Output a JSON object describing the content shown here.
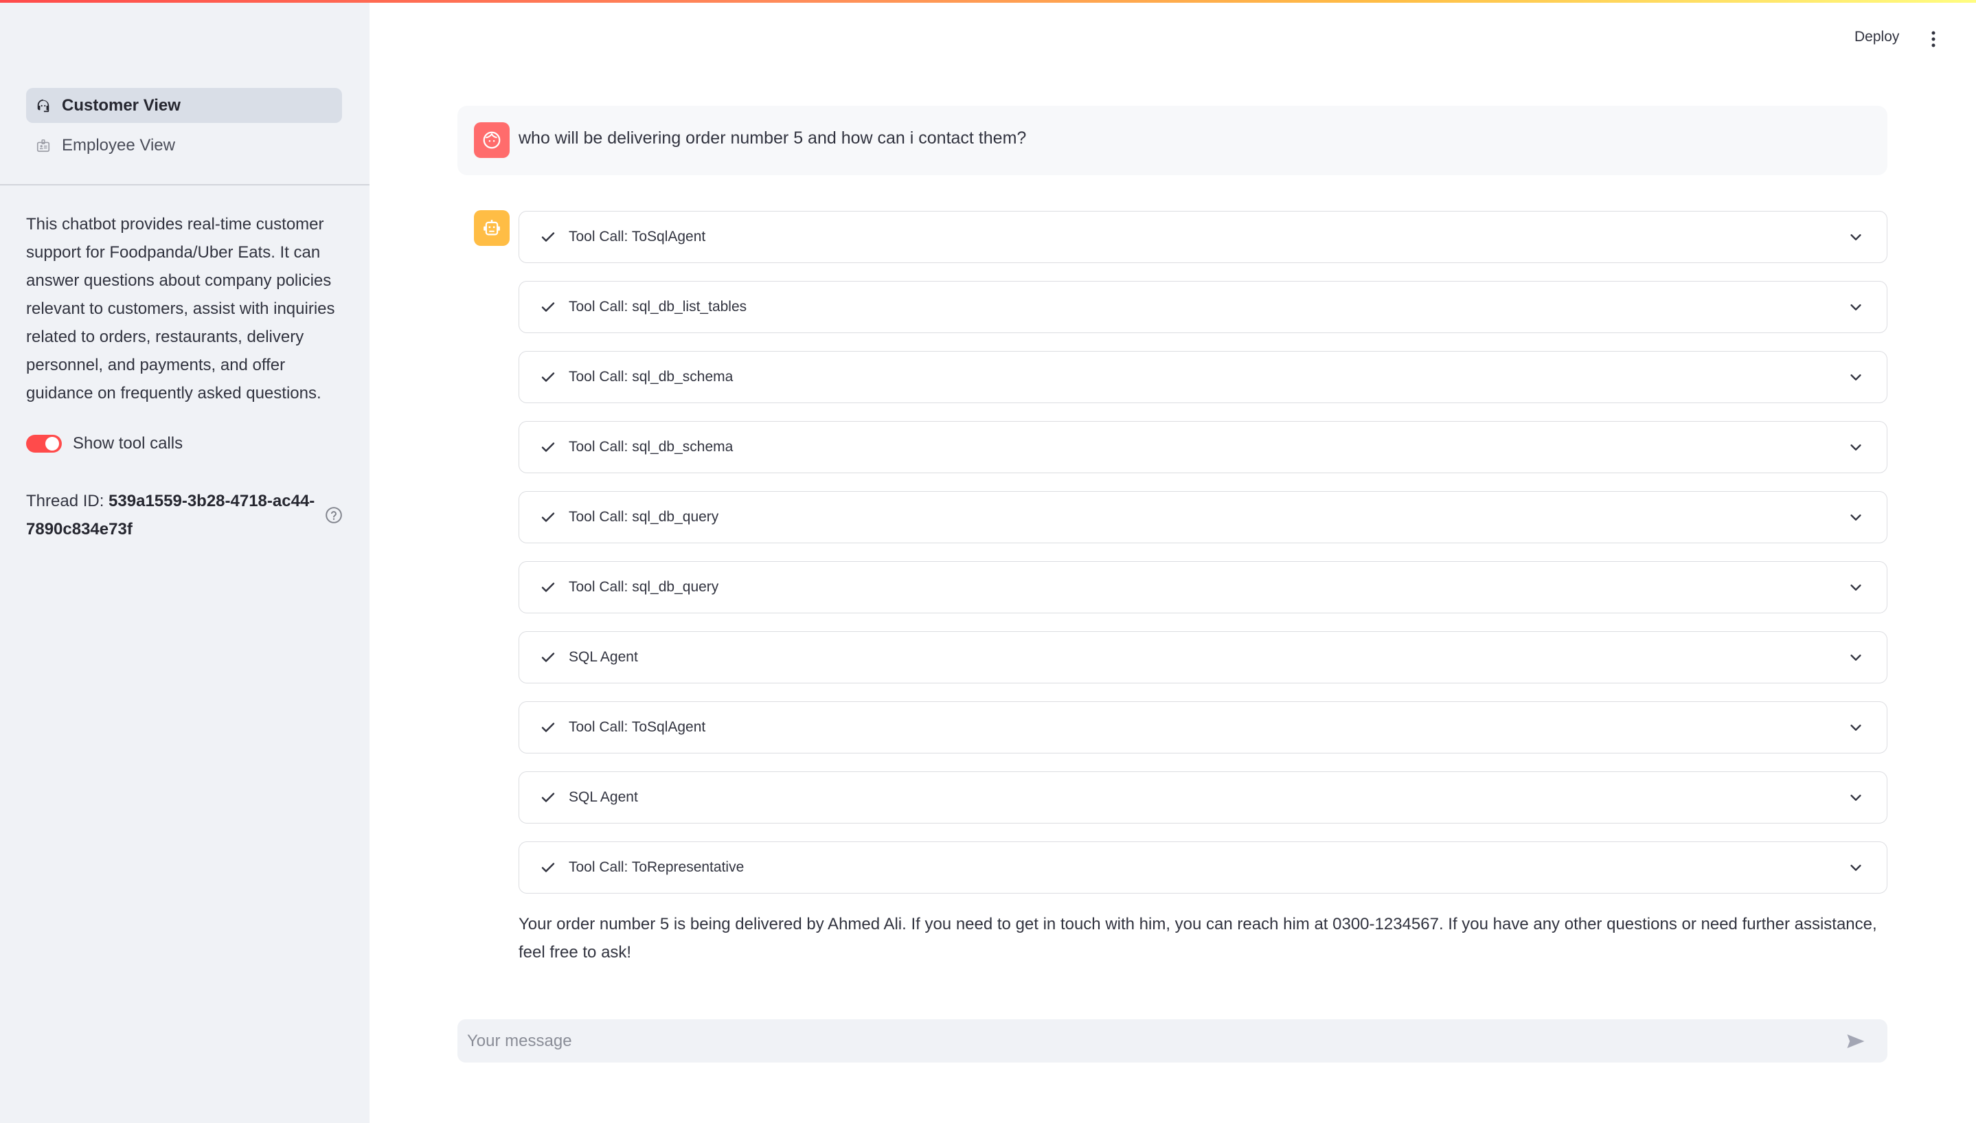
{
  "header": {
    "deploy_label": "Deploy",
    "menu_icon": "vertical-ellipsis-icon"
  },
  "sidebar": {
    "nav": [
      {
        "label": "Customer View",
        "icon": "support-agent-icon",
        "active": true
      },
      {
        "label": "Employee View",
        "icon": "id-badge-icon",
        "active": false
      }
    ],
    "description": "This chatbot provides real-time customer support for Foodpanda/Uber Eats. It can answer questions about company policies relevant to customers, assist with inquiries related to orders, restaurants, delivery personnel, and payments, and offer guidance on frequently asked questions.",
    "toggle": {
      "label": "Show tool calls",
      "on": true
    },
    "thread": {
      "label": "Thread ID: ",
      "value": "539a1559-3b28-4718-ac44-7890c834e73f"
    },
    "help_icon": "help-circle-icon"
  },
  "chat": {
    "user_message": "who will be delivering order number 5 and how can i contact them?",
    "expanders": [
      {
        "label": "Tool Call: ToSqlAgent",
        "status": "complete"
      },
      {
        "label": "Tool Call: sql_db_list_tables",
        "status": "complete"
      },
      {
        "label": "Tool Call: sql_db_schema",
        "status": "complete"
      },
      {
        "label": "Tool Call: sql_db_schema",
        "status": "complete"
      },
      {
        "label": "Tool Call: sql_db_query",
        "status": "complete"
      },
      {
        "label": "Tool Call: sql_db_query",
        "status": "complete"
      },
      {
        "label": "SQL Agent",
        "status": "complete"
      },
      {
        "label": "Tool Call: ToSqlAgent",
        "status": "complete"
      },
      {
        "label": "SQL Agent",
        "status": "complete"
      },
      {
        "label": "Tool Call: ToRepresentative",
        "status": "complete"
      }
    ],
    "assistant_response": "Your order number 5 is being delivered by Ahmed Ali. If you need to get in touch with him, you can reach him at 0300-1234567. If you have any other questions or need further assistance, feel free to ask!"
  },
  "input": {
    "placeholder": "Your message",
    "value": ""
  },
  "colors": {
    "accent": "#ff4b4b",
    "user_avatar": "#ff6c6c",
    "bot_avatar": "#ffbd45",
    "sidebar_bg": "#f0f2f6"
  }
}
